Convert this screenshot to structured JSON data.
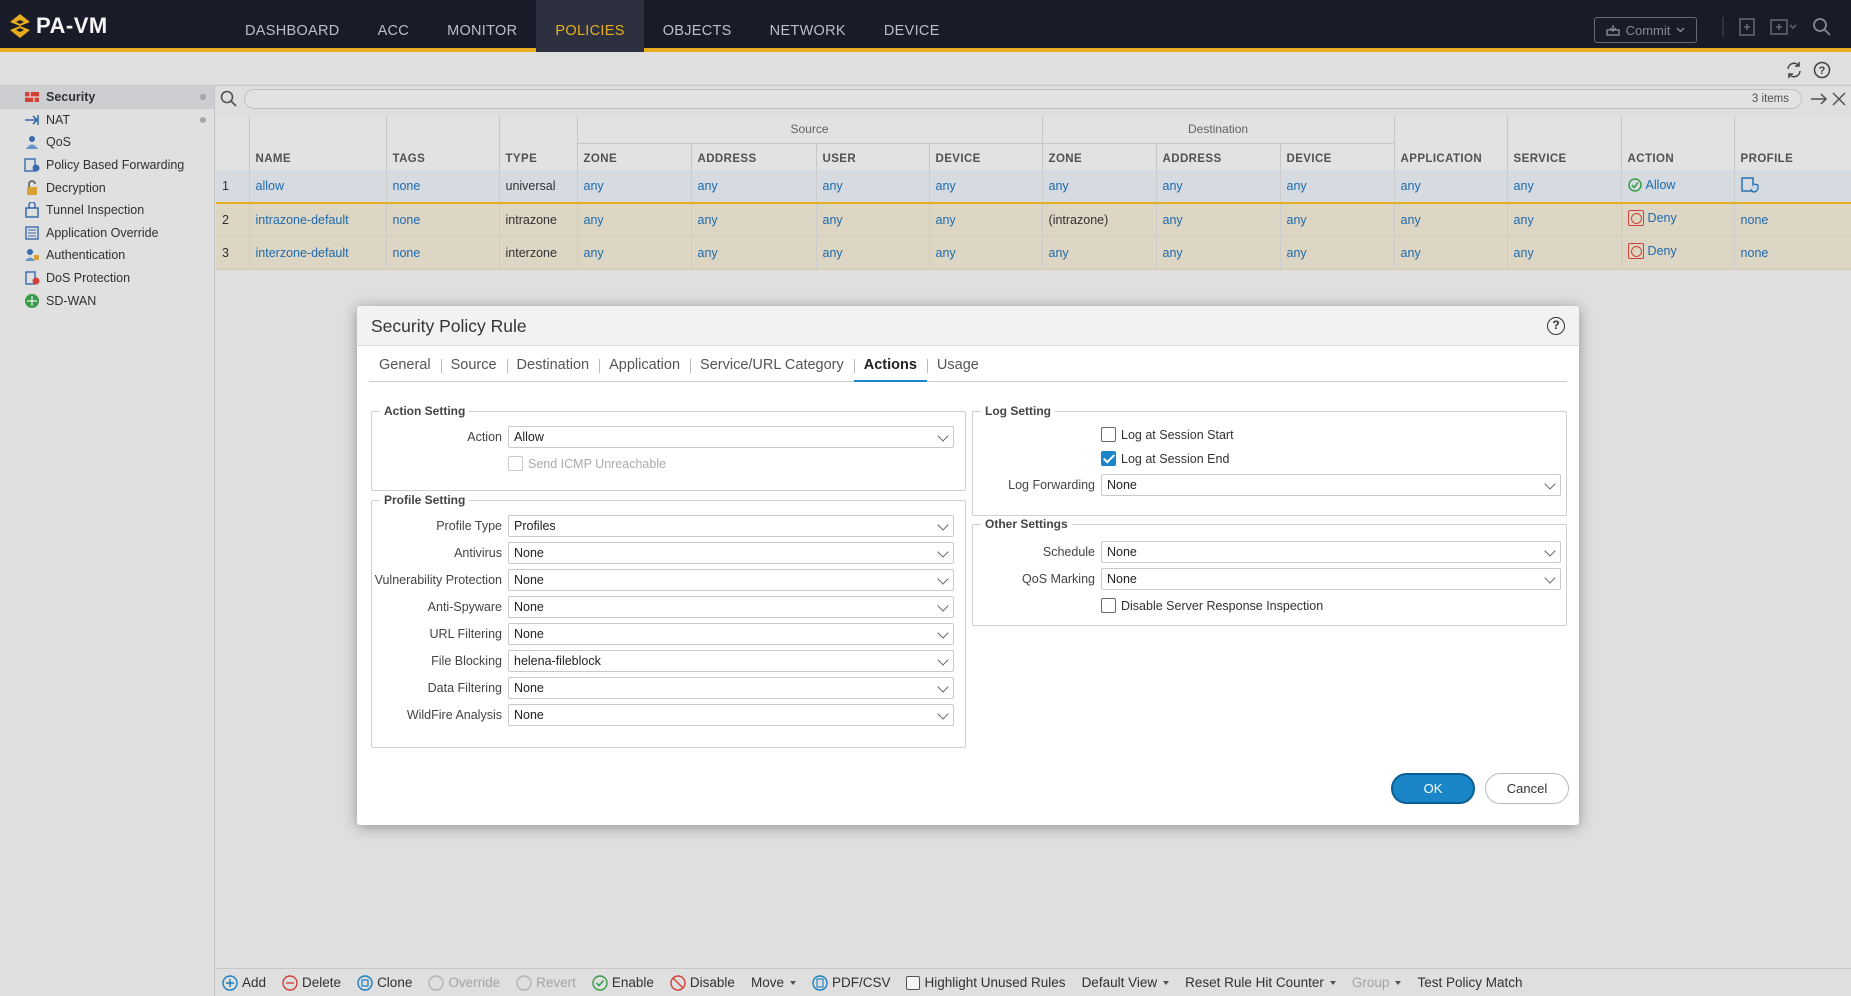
{
  "app": {
    "logo_text": "PA-VM",
    "nav": [
      "DASHBOARD",
      "ACC",
      "MONITOR",
      "POLICIES",
      "OBJECTS",
      "NETWORK",
      "DEVICE"
    ],
    "commit_label": "Commit",
    "accent_color": "#f1b521",
    "primary_color": "#1a86c8"
  },
  "sidebar": {
    "items": [
      {
        "label": "Security",
        "icon": "security-policy-icon"
      },
      {
        "label": "NAT",
        "icon": "nat-icon"
      },
      {
        "label": "QoS",
        "icon": "qos-icon"
      },
      {
        "label": "Policy Based Forwarding",
        "icon": "pbf-icon"
      },
      {
        "label": "Decryption",
        "icon": "decryption-icon"
      },
      {
        "label": "Tunnel Inspection",
        "icon": "tunnel-inspection-icon"
      },
      {
        "label": "Application Override",
        "icon": "app-override-icon"
      },
      {
        "label": "Authentication",
        "icon": "authentication-icon"
      },
      {
        "label": "DoS Protection",
        "icon": "dos-protection-icon"
      },
      {
        "label": "SD-WAN",
        "icon": "sdwan-icon"
      }
    ]
  },
  "search": {
    "items_count": "3 items"
  },
  "table": {
    "group_source": "Source",
    "group_destination": "Destination",
    "headers": [
      "NAME",
      "TAGS",
      "TYPE",
      "ZONE",
      "ADDRESS",
      "USER",
      "DEVICE",
      "ZONE",
      "ADDRESS",
      "DEVICE",
      "APPLICATION",
      "SERVICE",
      "ACTION",
      "PROFILE"
    ],
    "rows": [
      {
        "num": "1",
        "name": "allow",
        "tags": "none",
        "type": "universal",
        "src_zone": "any",
        "src_address": "any",
        "src_user": "any",
        "src_device": "any",
        "dst_zone": "any",
        "dst_address": "any",
        "dst_device": "any",
        "application": "any",
        "service": "any",
        "action": "Allow",
        "profile": ""
      },
      {
        "num": "2",
        "name": "intrazone-default",
        "tags": "none",
        "type": "intrazone",
        "src_zone": "any",
        "src_address": "any",
        "src_user": "any",
        "src_device": "any",
        "dst_zone": "(intrazone)",
        "dst_address": "any",
        "dst_device": "any",
        "application": "any",
        "service": "any",
        "action": "Deny",
        "profile": "none"
      },
      {
        "num": "3",
        "name": "interzone-default",
        "tags": "none",
        "type": "interzone",
        "src_zone": "any",
        "src_address": "any",
        "src_user": "any",
        "src_device": "any",
        "dst_zone": "any",
        "dst_address": "any",
        "dst_device": "any",
        "application": "any",
        "service": "any",
        "action": "Deny",
        "profile": "none"
      }
    ]
  },
  "modal": {
    "title": "Security Policy Rule",
    "tabs": [
      "General",
      "Source",
      "Destination",
      "Application",
      "Service/URL Category",
      "Actions",
      "Usage"
    ],
    "active_tab": "Actions",
    "action_setting": {
      "legend": "Action Setting",
      "action_label": "Action",
      "action_value": "Allow",
      "icmp_label": "Send ICMP Unreachable"
    },
    "profile_setting": {
      "legend": "Profile Setting",
      "fields": [
        {
          "label": "Profile Type",
          "value": "Profiles"
        },
        {
          "label": "Antivirus",
          "value": "None"
        },
        {
          "label": "Vulnerability Protection",
          "value": "None"
        },
        {
          "label": "Anti-Spyware",
          "value": "None"
        },
        {
          "label": "URL Filtering",
          "value": "None"
        },
        {
          "label": "File Blocking",
          "value": "helena-fileblock"
        },
        {
          "label": "Data Filtering",
          "value": "None"
        },
        {
          "label": "WildFire Analysis",
          "value": "None"
        }
      ]
    },
    "log_setting": {
      "legend": "Log Setting",
      "log_start_label": "Log at Session Start",
      "log_start_checked": false,
      "log_end_label": "Log at Session End",
      "log_end_checked": true,
      "forwarding_label": "Log Forwarding",
      "forwarding_value": "None"
    },
    "other_settings": {
      "legend": "Other Settings",
      "schedule_label": "Schedule",
      "schedule_value": "None",
      "qos_label": "QoS Marking",
      "qos_value": "None",
      "dsri_label": "Disable Server Response Inspection"
    },
    "ok_label": "OK",
    "cancel_label": "Cancel"
  },
  "toolbar": {
    "add": "Add",
    "delete": "Delete",
    "clone": "Clone",
    "override": "Override",
    "revert": "Revert",
    "enable": "Enable",
    "disable": "Disable",
    "move": "Move",
    "pdfcsv": "PDF/CSV",
    "highlight": "Highlight Unused Rules",
    "default_view": "Default View",
    "reset_counter": "Reset Rule Hit Counter",
    "group": "Group",
    "test_match": "Test Policy Match"
  }
}
